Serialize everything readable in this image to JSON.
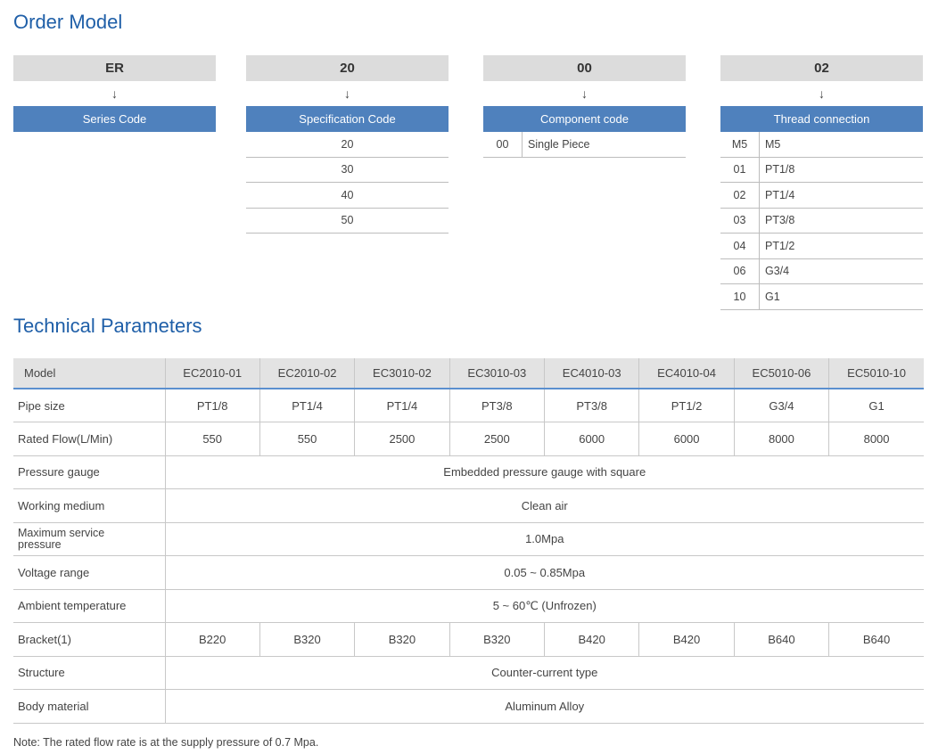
{
  "order_model": {
    "title": "Order Model",
    "columns": [
      {
        "code": "ER",
        "arrow": "↓",
        "label": "Series Code",
        "options": []
      },
      {
        "code": "20",
        "arrow": "↓",
        "label": "Specification Code",
        "options": [
          {
            "code": "",
            "desc": "20"
          },
          {
            "code": "",
            "desc": "30"
          },
          {
            "code": "",
            "desc": "40"
          },
          {
            "code": "",
            "desc": "50"
          }
        ]
      },
      {
        "code": "00",
        "arrow": "↓",
        "label": "Component code",
        "options": [
          {
            "code": "00",
            "desc": "Single Piece"
          }
        ]
      },
      {
        "code": "02",
        "arrow": "↓",
        "label": "Thread connection",
        "options": [
          {
            "code": "M5",
            "desc": "M5"
          },
          {
            "code": "01",
            "desc": "PT1/8"
          },
          {
            "code": "02",
            "desc": "PT1/4"
          },
          {
            "code": "03",
            "desc": "PT3/8"
          },
          {
            "code": "04",
            "desc": "PT1/2"
          },
          {
            "code": "06",
            "desc": "G3/4"
          },
          {
            "code": "10",
            "desc": "G1"
          }
        ]
      }
    ]
  },
  "technical_parameters": {
    "title": "Technical Parameters",
    "header_label": "Model",
    "models": [
      "EC2010-01",
      "EC2010-02",
      "EC3010-02",
      "EC3010-03",
      "EC4010-03",
      "EC4010-04",
      "EC5010-06",
      "EC5010-10"
    ],
    "rows": [
      {
        "label": "Pipe size",
        "values": [
          "PT1/8",
          "PT1/4",
          "PT1/4",
          "PT3/8",
          "PT3/8",
          "PT1/2",
          "G3/4",
          "G1"
        ]
      },
      {
        "label": "Rated Flow(L/Min)",
        "values": [
          "550",
          "550",
          "2500",
          "2500",
          "6000",
          "6000",
          "8000",
          "8000"
        ]
      },
      {
        "label": "Pressure gauge",
        "span": "Embedded pressure gauge with square"
      },
      {
        "label": "Working medium",
        "span": "Clean air"
      },
      {
        "label": "Maximum service\npressure",
        "span": "1.0Mpa"
      },
      {
        "label": "Voltage range",
        "span": "0.05 ~ 0.85Mpa"
      },
      {
        "label": "Ambient temperature",
        "span": "5 ~ 60℃ (Unfrozen)"
      },
      {
        "label": "Bracket(1)",
        "values": [
          "B220",
          "B320",
          "B320",
          "B320",
          "B420",
          "B420",
          "B640",
          "B640"
        ]
      },
      {
        "label": "Structure",
        "span": "Counter-current type"
      },
      {
        "label": "Body material",
        "span": "Aluminum Alloy"
      }
    ],
    "note": "Note: The rated flow rate is at the supply pressure of 0.7 Mpa."
  }
}
